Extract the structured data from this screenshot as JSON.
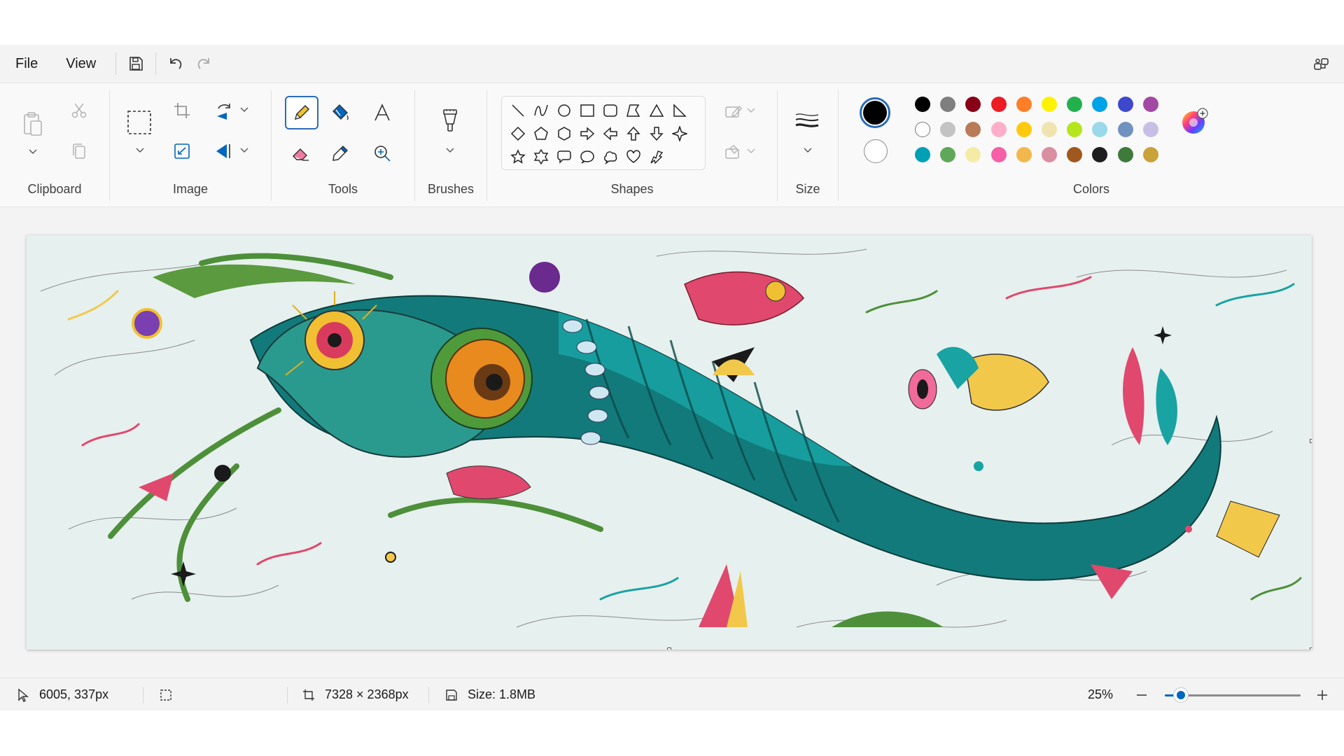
{
  "menu": {
    "file": "File",
    "view": "View"
  },
  "ribbon": {
    "groups": {
      "clipboard": "Clipboard",
      "image": "Image",
      "tools": "Tools",
      "brushes": "Brushes",
      "shapes": "Shapes",
      "size": "Size",
      "colors": "Colors"
    },
    "active_tool": "pencil",
    "primary_color": "#000000",
    "secondary_color": "#ffffff",
    "palette": [
      [
        "#000000",
        "#7f7f7f",
        "#880015",
        "#ed1c24",
        "#ff7f27",
        "#fff200",
        "#22b14c",
        "#00a2e8",
        "#3f48cc",
        "#a349a4"
      ],
      [
        "#ffffff",
        "#c3c3c3",
        "#b97a57",
        "#ffaec9",
        "#ffc90e",
        "#efe4b0",
        "#b5e61d",
        "#99d9ea",
        "#7092be",
        "#c8bfe7"
      ],
      [
        "#00a0b4",
        "#5fa85a",
        "#f5eba6",
        "#f55fa7",
        "#f2b84b",
        "#d98fa0",
        "#a0581f",
        "#1e1e1e",
        "#3e7a3a",
        "#c9a23a"
      ]
    ]
  },
  "status": {
    "cursor_position": "6005, 337px",
    "canvas_size": "7328 × 2368px",
    "file_size": "Size: 1.8MB",
    "zoom": "25%",
    "zoom_fraction": 0.12
  }
}
